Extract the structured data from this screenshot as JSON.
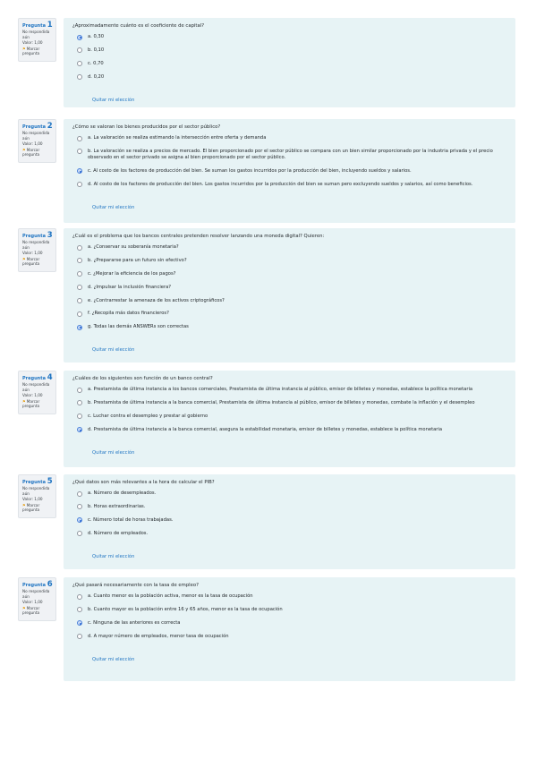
{
  "labels": {
    "pregunta": "Pregunta",
    "no_respondida_1": "No respondida",
    "no_respondida_2": "aún",
    "valor": "Valor: 1,00",
    "marcar_1": "Marcar",
    "marcar_2": "pregunta",
    "flag_icon": "flag-icon",
    "quitar": "Quitar mi elección",
    "accent_color": "#1f74c2",
    "panel_color": "#e7f3f5",
    "flag_color": "#e5a21e"
  },
  "questions": [
    {
      "number": "1",
      "text": "¿Aproximadamente cuánto es el coeficiente de capital?",
      "selected": 0,
      "options": [
        "a. 0,30",
        "b. 0,10",
        "c. 0,70",
        "d. 0,20"
      ]
    },
    {
      "number": "2",
      "text": "¿Cómo se valoran los bienes producidos por el sector público?",
      "selected": 2,
      "options": [
        "a. La valoración se realiza estimando la intersección entre oferta y demanda",
        "b. La valoración se realiza a precios de mercado. El bien proporcionado por el sector público se compara con un bien similar proporcionado por la industria privada y el precio observado en el sector privado se asigna al bien proporcionado por el sector público.",
        "c. Al costo de los factores de producción del bien. Se suman los gastos incurridos por la producción del bien, incluyendo sueldos y salarios.",
        "d. Al costo de los factores de producción del bien. Los gastos incurridos por la producción del bien se suman pero excluyendo sueldos y salarios, así como beneficios."
      ]
    },
    {
      "number": "3",
      "text": "¿Cuál es el problema que los bancos centrales pretenden resolver lanzando una moneda digital? Quieren:",
      "selected": 6,
      "options": [
        "a. ¿Conservar su soberanía monetaria?",
        "b. ¿Prepararse para un futuro sin efectivo?",
        "c. ¿Mejorar la eficiencia de los pagos?",
        "d. ¿Impulsar la inclusión financiera?",
        "e. ¿Contrarrestar la amenaza de los activos criptográficos?",
        "f. ¿Recopila más datos financieros?",
        "g. Todas las demás ANSWERs son correctas"
      ]
    },
    {
      "number": "4",
      "text": "¿Cuáles de los siguientes son función de un banco central?",
      "selected": 3,
      "options": [
        "a. Prestamista de última instancia a los bancos comerciales, Prestamista de última instancia al público, emisor de billetes y monedas, establece la política monetaria",
        "b. Prestamista de última instancia a la banca comercial, Prestamista de última instancia al público, emisor de billetes y monedas, combate la inflación y el desempleo",
        "c. Luchar contra el desempleo y prestar al gobierno",
        "d. Prestamista de última instancia a la banca comercial, asegura la estabilidad monetaria, emisor de billetes y monedas, establece la política monetaria"
      ]
    },
    {
      "number": "5",
      "text": "¿Qué datos son más relevantes a la hora de calcular el PIB?",
      "selected": 2,
      "options": [
        "a. Número de desempleados.",
        "b. Horas extraordinarias.",
        "c. Número total de horas trabajadas.",
        "d. Número de empleados."
      ]
    },
    {
      "number": "6",
      "text": "¿Qué pasará necesariamente con la tasa de empleo?",
      "selected": 2,
      "options": [
        "a. Cuanto menor es la población activa, menor es la tasa de ocupación",
        "b. Cuanto mayor es la población entre 16 y 65 años, menor es la tasa de ocupación",
        "c. Ninguna de las anteriores es correcta",
        "d. A mayor número de empleados, menor tasa de ocupación"
      ]
    }
  ]
}
